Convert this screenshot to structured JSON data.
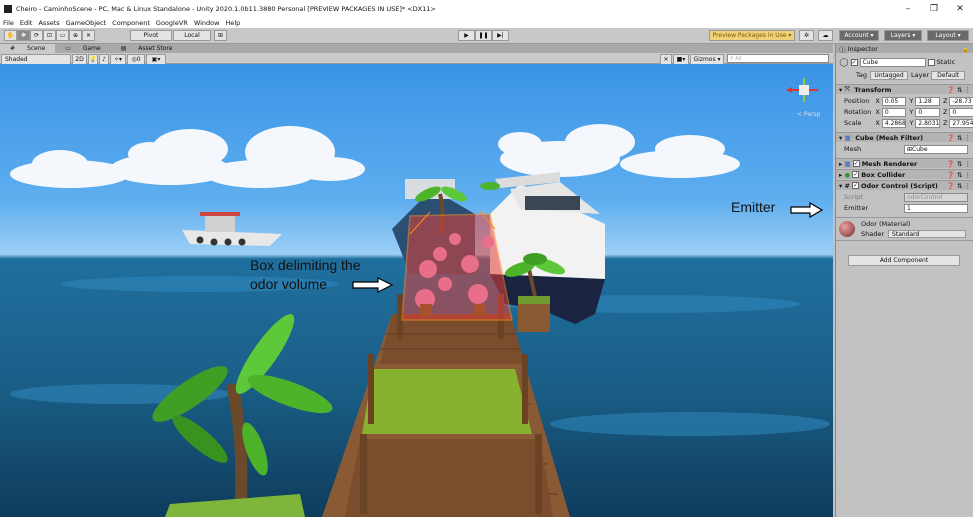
{
  "window": {
    "title": "Cheiro - CaminhoScene - PC, Mac & Linux Standalone - Unity 2020.1.0b11.3880 Personal [PREVIEW PACKAGES IN USE]* <DX11>",
    "minimize": "–",
    "maximize": "❐",
    "close": "✕"
  },
  "menu": [
    "File",
    "Edit",
    "Assets",
    "GameObject",
    "Component",
    "GoogleVR",
    "Window",
    "Help"
  ],
  "toolbar": {
    "pivot": "Pivot",
    "local": "Local",
    "play": "▶",
    "pause": "❚❚",
    "step": "▶|",
    "preview": "Preview Packages in Use ▾",
    "account": "Account ▾",
    "layers": "Layers ▾",
    "layout": "Layout ▾"
  },
  "tabs": {
    "scene": "Scene",
    "game": "Game",
    "asset_store": "Asset Store"
  },
  "scene_bar": {
    "shading": "Shaded",
    "mode_2d": "2D",
    "gizmos": "Gizmos ▾",
    "search_placeholder": "All",
    "persp": "< Persp"
  },
  "annotations": {
    "box_line1": "Box delimiting the",
    "box_line2": "odor volume",
    "emitter": "Emitter"
  },
  "inspector": {
    "tab": "Inspector",
    "object_name": "Cube",
    "static": "Static",
    "tag_label": "Tag",
    "tag_value": "Untagged",
    "layer_label": "Layer",
    "layer_value": "Default",
    "transform": {
      "title": "Transform",
      "position_label": "Position",
      "position": [
        "0.05",
        "1.28",
        "-28.73"
      ],
      "rotation_label": "Rotation",
      "rotation": [
        "0",
        "0",
        "0"
      ],
      "scale_label": "Scale",
      "scale": [
        "4.2868",
        "2.8031",
        "27.954"
      ]
    },
    "axes": [
      "X",
      "Y",
      "Z"
    ],
    "mesh_filter": {
      "title": "Cube (Mesh Filter)",
      "mesh_label": "Mesh",
      "mesh_value": "Cube"
    },
    "mesh_renderer": "Mesh Renderer",
    "box_collider": "Box Collider",
    "odor_control": {
      "title": "Odor Control (Script)",
      "script_label": "Script",
      "script_value": "odorControl",
      "emitter_label": "Emitter",
      "emitter_value": "1"
    },
    "material": {
      "title": "Odor (Material)",
      "shader_label": "Shader",
      "shader_value": "Standard"
    },
    "add_component": "Add Component"
  }
}
